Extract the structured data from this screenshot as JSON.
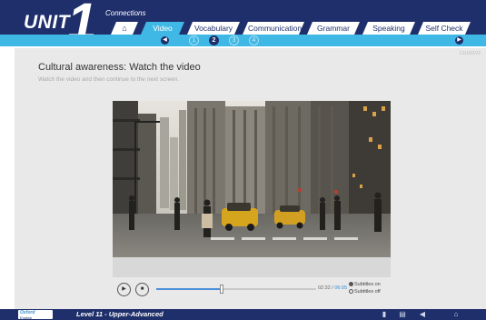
{
  "header": {
    "unit_word": "UNIT",
    "unit_number": "1",
    "unit_title": "Connections",
    "tabs": [
      {
        "label": "⌂"
      },
      {
        "label": "Video"
      },
      {
        "label": "Vocabulary"
      },
      {
        "label": "Communication"
      },
      {
        "label": "Grammar"
      },
      {
        "label": "Speaking"
      },
      {
        "label": "Self Check"
      }
    ],
    "active_tab": "Video"
  },
  "subnav": {
    "prev_icon": "◀",
    "next_icon": "▶",
    "pages": [
      "1",
      "2",
      "3",
      "4"
    ],
    "current_page": "2"
  },
  "main": {
    "screen_number": "L11U01V2",
    "title": "Cultural awareness: Watch the video",
    "instructions": "Watch the video and then continue to the next screen."
  },
  "player": {
    "play_icon": "▶",
    "stop_icon": "■",
    "progress": 0.41,
    "current_time": "02:32",
    "total_time": "06:05",
    "time_separator": "/",
    "subtitles_on_label": "Subtitles on",
    "subtitles_off_label": "Subtitles off"
  },
  "footer": {
    "logo_brand": "Oxford",
    "logo_sub": "English",
    "level": "Level 11 - Upper-Advanced",
    "icons": [
      "notebook-icon",
      "document-icon",
      "audio-icon",
      "home-icon"
    ]
  },
  "colors": {
    "navy": "#1f2f6b",
    "cyan": "#3fb8e5",
    "content_bg": "#e9e9e9"
  }
}
